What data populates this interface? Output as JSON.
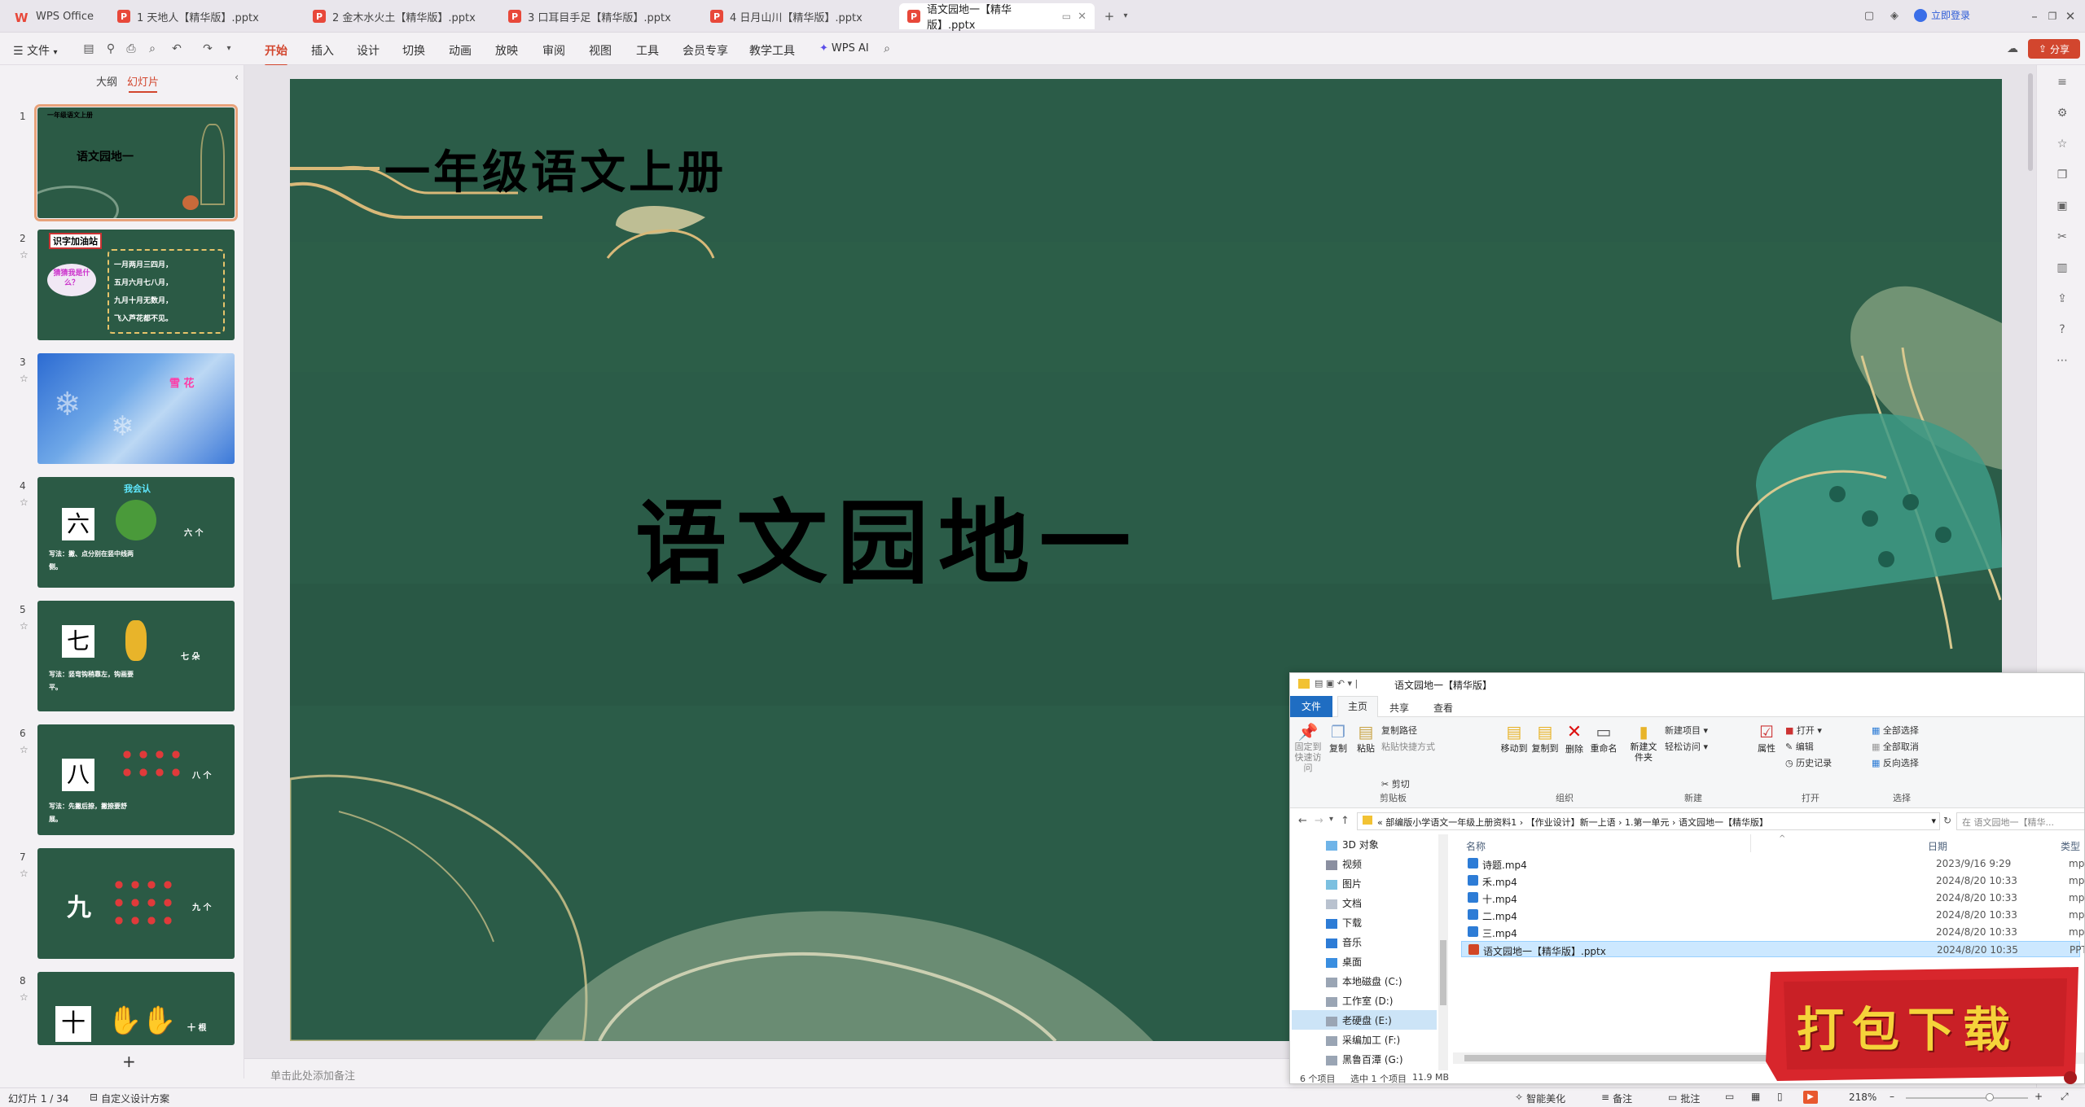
{
  "titlebar": {
    "app_label": "WPS Office",
    "tabs": [
      {
        "label": "1 天地人【精华版】.pptx"
      },
      {
        "label": "2 金木水火土【精华版】.pptx"
      },
      {
        "label": "3 口耳目手足【精华版】.pptx"
      },
      {
        "label": "4 日月山川【精华版】.pptx"
      },
      {
        "label": "语文园地一【精华版】.pptx"
      }
    ],
    "login_label": "立即登录"
  },
  "ribbon": {
    "file_label": "文件",
    "menus": [
      "开始",
      "插入",
      "设计",
      "切换",
      "动画",
      "放映",
      "审阅",
      "视图",
      "工具",
      "会员专享",
      "教学工具"
    ],
    "ai_label": "WPS AI",
    "share_label": "分享"
  },
  "panel": {
    "tab_outline": "大纲",
    "tab_slides": "幻灯片",
    "add_label": "+",
    "thumbs": [
      {
        "num": "1",
        "title": "语文园地一",
        "sub": "一年级语文上册"
      },
      {
        "num": "2",
        "title": "识字加油站",
        "t1": "一月两月三四月，",
        "t2": "五月六月七八月，",
        "t3": "九月十月无数月，",
        "t4": "飞入芦花都不见。",
        "cloud": "猜猜我是什么？"
      },
      {
        "num": "3",
        "title": "雪 花"
      },
      {
        "num": "4",
        "title": "我会认",
        "char": "六",
        "cap": "写法：撇、点分别在竖中线两侧。",
        "w": "六 个"
      },
      {
        "num": "5",
        "char": "七",
        "cap": "写法：竖弯钩稍靠左，钩画要平。",
        "w": "七 朵"
      },
      {
        "num": "6",
        "char": "八",
        "cap": "写法：先撇后捺，撇捺要舒展。",
        "w": "八 个"
      },
      {
        "num": "7",
        "char": "九",
        "w": "九 个"
      },
      {
        "num": "8",
        "char": "十",
        "w": "十 根"
      }
    ]
  },
  "slide": {
    "subtitle": "一年级语文上册",
    "title": "语文园地一"
  },
  "notes_placeholder": "单击此处添加备注",
  "status": {
    "slide_info": "幻灯片 1 / 34",
    "theme": "自定义设计方案",
    "beautify": "智能美化",
    "notes": "备注",
    "comments": "批注",
    "zoom": "218%"
  },
  "explorer": {
    "title": "语文园地一【精华版】",
    "tabs": [
      "文件",
      "主页",
      "共享",
      "查看"
    ],
    "ribbon": {
      "pin": "固定到快速访问",
      "copy": "复制",
      "paste": "粘贴",
      "copy_path": "复制路径",
      "paste_shortcut": "粘贴快捷方式",
      "cut": "剪切",
      "move_to": "移动到",
      "copy_to": "复制到",
      "delete": "删除",
      "rename": "重命名",
      "new_folder": "新建文件夹",
      "new_item": "新建项目",
      "easy_access": "轻松访问",
      "properties": "属性",
      "open": "打开",
      "edit": "编辑",
      "history": "历史记录",
      "select_all": "全部选择",
      "select_none": "全部取消",
      "invert": "反向选择",
      "groups": [
        "剪贴板",
        "组织",
        "新建",
        "打开",
        "选择"
      ]
    },
    "path": [
      "部编版小学语文一年级上册资料1",
      "【作业设计】新一上语",
      "1.第一单元",
      "语文园地一【精华版】"
    ],
    "search_placeholder": "在 语文园地一【精华...",
    "tree": [
      "3D 对象",
      "视频",
      "图片",
      "文档",
      "下载",
      "音乐",
      "桌面",
      "本地磁盘 (C:)",
      "工作室 (D:)",
      "老硬盘 (E:)",
      "采编加工 (F:)",
      "黑鲁百潭 (G:)"
    ],
    "columns": {
      "name": "名称",
      "date": "日期",
      "type": "类型"
    },
    "files": [
      {
        "name": "诗题.mp4",
        "date": "2023/9/16 9:29",
        "type": "mp4"
      },
      {
        "name": "禾.mp4",
        "date": "2024/8/20 10:33",
        "type": "mp4"
      },
      {
        "name": "十.mp4",
        "date": "2024/8/20 10:33",
        "type": "mp4"
      },
      {
        "name": "二.mp4",
        "date": "2024/8/20 10:33",
        "type": "mp4"
      },
      {
        "name": "三.mp4",
        "date": "2024/8/20 10:33",
        "type": "mp4"
      },
      {
        "name": "语文园地一【精华版】.pptx",
        "date": "2024/8/20 10:35",
        "type": "PPT"
      }
    ],
    "status": {
      "count": "6 个项目",
      "selected": "选中 1 个项目",
      "size": "11.9 MB"
    }
  },
  "badge": {
    "text": "打包下载"
  },
  "colors": {
    "accent": "#d2462e",
    "slide_bg": "#2a5a47",
    "badge_red": "#d8262c",
    "badge_text": "#f5d33a"
  }
}
